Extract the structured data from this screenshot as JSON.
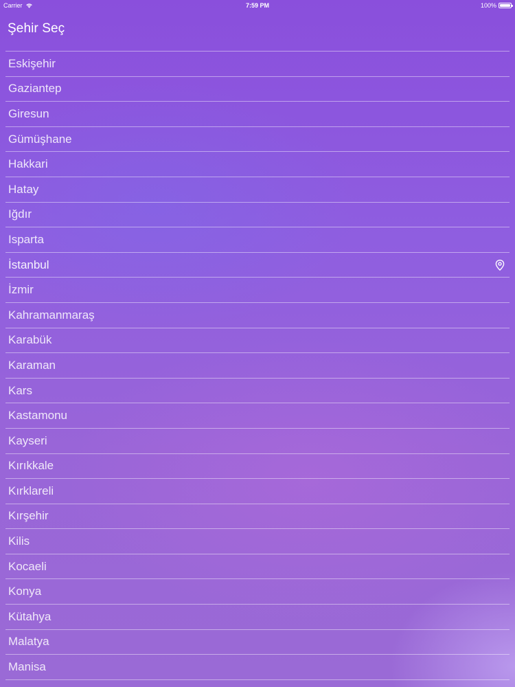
{
  "status_bar": {
    "carrier": "Carrier",
    "time": "7:59 PM",
    "battery": "100%",
    "battery_level": 1.0,
    "wifi_icon": "wifi-icon",
    "battery_icon": "battery-icon"
  },
  "header": {
    "title": "Şehir Seç"
  },
  "cities": [
    {
      "name": "Eskişehir",
      "selected": false
    },
    {
      "name": "Gaziantep",
      "selected": false
    },
    {
      "name": "Giresun",
      "selected": false
    },
    {
      "name": "Gümüşhane",
      "selected": false
    },
    {
      "name": "Hakkari",
      "selected": false
    },
    {
      "name": "Hatay",
      "selected": false
    },
    {
      "name": "Iğdır",
      "selected": false
    },
    {
      "name": "Isparta",
      "selected": false
    },
    {
      "name": "İstanbul",
      "selected": true,
      "icon": "location-pin-icon"
    },
    {
      "name": "İzmir",
      "selected": false
    },
    {
      "name": "Kahramanmaraş",
      "selected": false
    },
    {
      "name": "Karabük",
      "selected": false
    },
    {
      "name": "Karaman",
      "selected": false
    },
    {
      "name": "Kars",
      "selected": false
    },
    {
      "name": "Kastamonu",
      "selected": false
    },
    {
      "name": "Kayseri",
      "selected": false
    },
    {
      "name": "Kırıkkale",
      "selected": false
    },
    {
      "name": "Kırklareli",
      "selected": false
    },
    {
      "name": "Kırşehir",
      "selected": false
    },
    {
      "name": "Kilis",
      "selected": false
    },
    {
      "name": "Kocaeli",
      "selected": false
    },
    {
      "name": "Konya",
      "selected": false
    },
    {
      "name": "Kütahya",
      "selected": false
    },
    {
      "name": "Malatya",
      "selected": false
    },
    {
      "name": "Manisa",
      "selected": false
    }
  ],
  "colors": {
    "background_top": "#8a4fdc",
    "background_bottom": "#9a6ad6",
    "text": "#ffffff"
  }
}
